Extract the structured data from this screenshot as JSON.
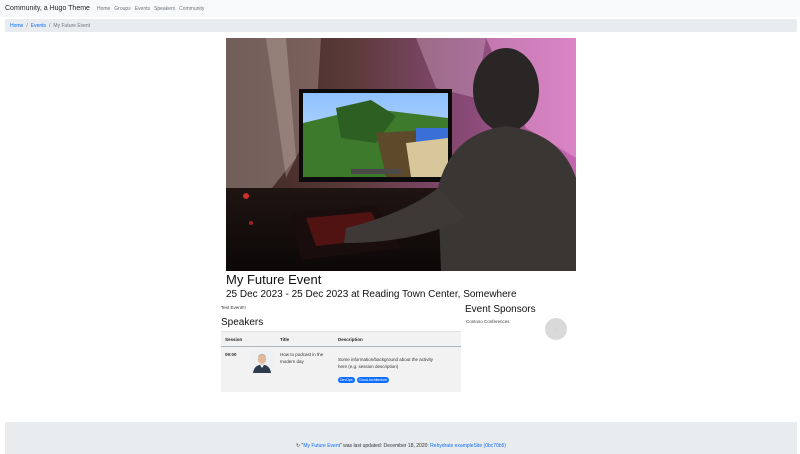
{
  "navbar": {
    "brand": "Community, a Hugo Theme",
    "links": [
      "Home",
      "Groups",
      "Events",
      "Speakers",
      "Community"
    ]
  },
  "breadcrumb": {
    "items": [
      "Home",
      "Events"
    ],
    "separator": "/",
    "active": "My Future Event"
  },
  "event": {
    "title": "My Future Event",
    "date_location": "25 Dec 2023 - 25 Dec 2023 at Reading Town Center, Somewhere",
    "description": "Test Event!!!"
  },
  "speakers": {
    "heading": "Speakers",
    "columns": [
      "Session",
      "Title",
      "Description"
    ],
    "rows": [
      {
        "time": "09:00",
        "title_lines": [
          "How to podcast in the",
          "modern day"
        ],
        "description_lines": [
          "Some information/background about the activity",
          "here (e.g. session description)"
        ],
        "tags": [
          "DevOps",
          "Cloud Architecture"
        ]
      }
    ]
  },
  "sponsors": {
    "heading": "Event Sponsors",
    "name": "Contoso Conferences"
  },
  "footer": {
    "prefix": "\"",
    "link1": "My Future Event",
    "middle": "\" was last updated: December 18, 2020: ",
    "link2": "Rehydrate exampleSite (0bc70b5)"
  },
  "colors": {
    "link": "#0d6efd",
    "navbar_bg": "#f8f9fa",
    "breadcrumb_bg": "#e9ecef",
    "table_bg": "#f2f2f2",
    "tag_bg": "#0d6efd"
  },
  "icons": {
    "footer": "history-icon"
  }
}
